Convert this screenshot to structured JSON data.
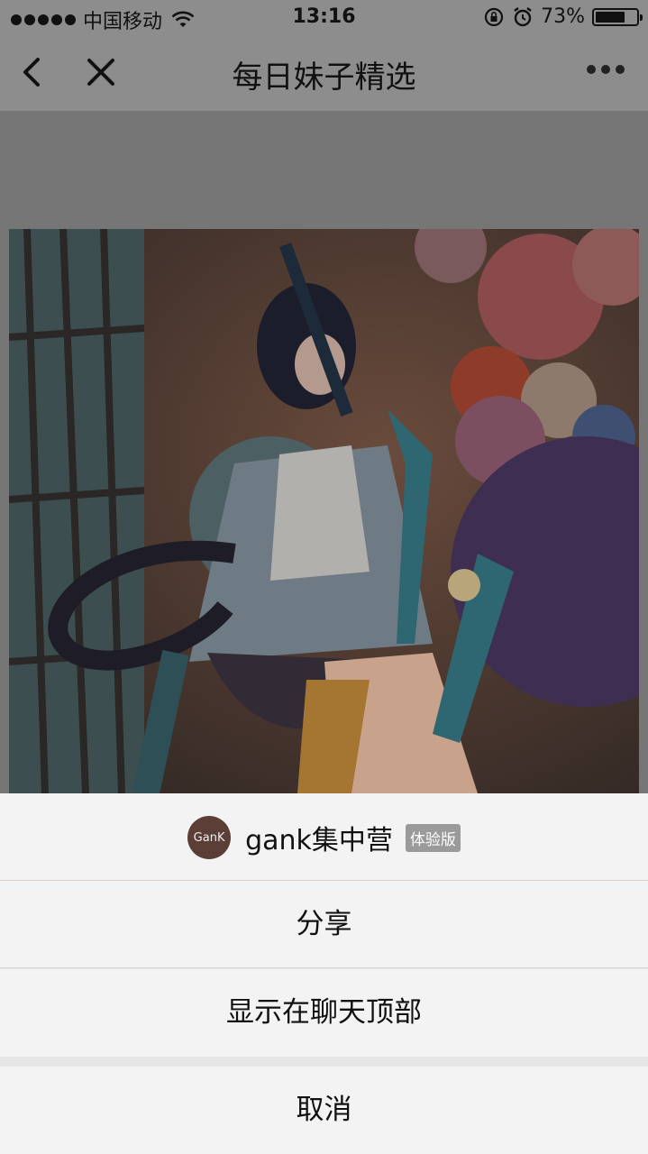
{
  "status_bar": {
    "carrier": "中国移动",
    "time": "13:16",
    "battery_percent": "73%",
    "battery_level": 0.73,
    "icons": [
      "signal-dots-icon",
      "wifi-icon",
      "orientation-lock-icon",
      "alarm-icon",
      "battery-icon"
    ]
  },
  "nav": {
    "title": "每日妹子精选",
    "icons": [
      "back-icon",
      "close-icon",
      "more-icon"
    ]
  },
  "sheet": {
    "avatar_text": "GanK",
    "app_name": "gank集中营",
    "badge": "体验版",
    "items": [
      {
        "label": "分享"
      },
      {
        "label": "显示在聊天顶部"
      }
    ],
    "cancel_label": "取消"
  }
}
